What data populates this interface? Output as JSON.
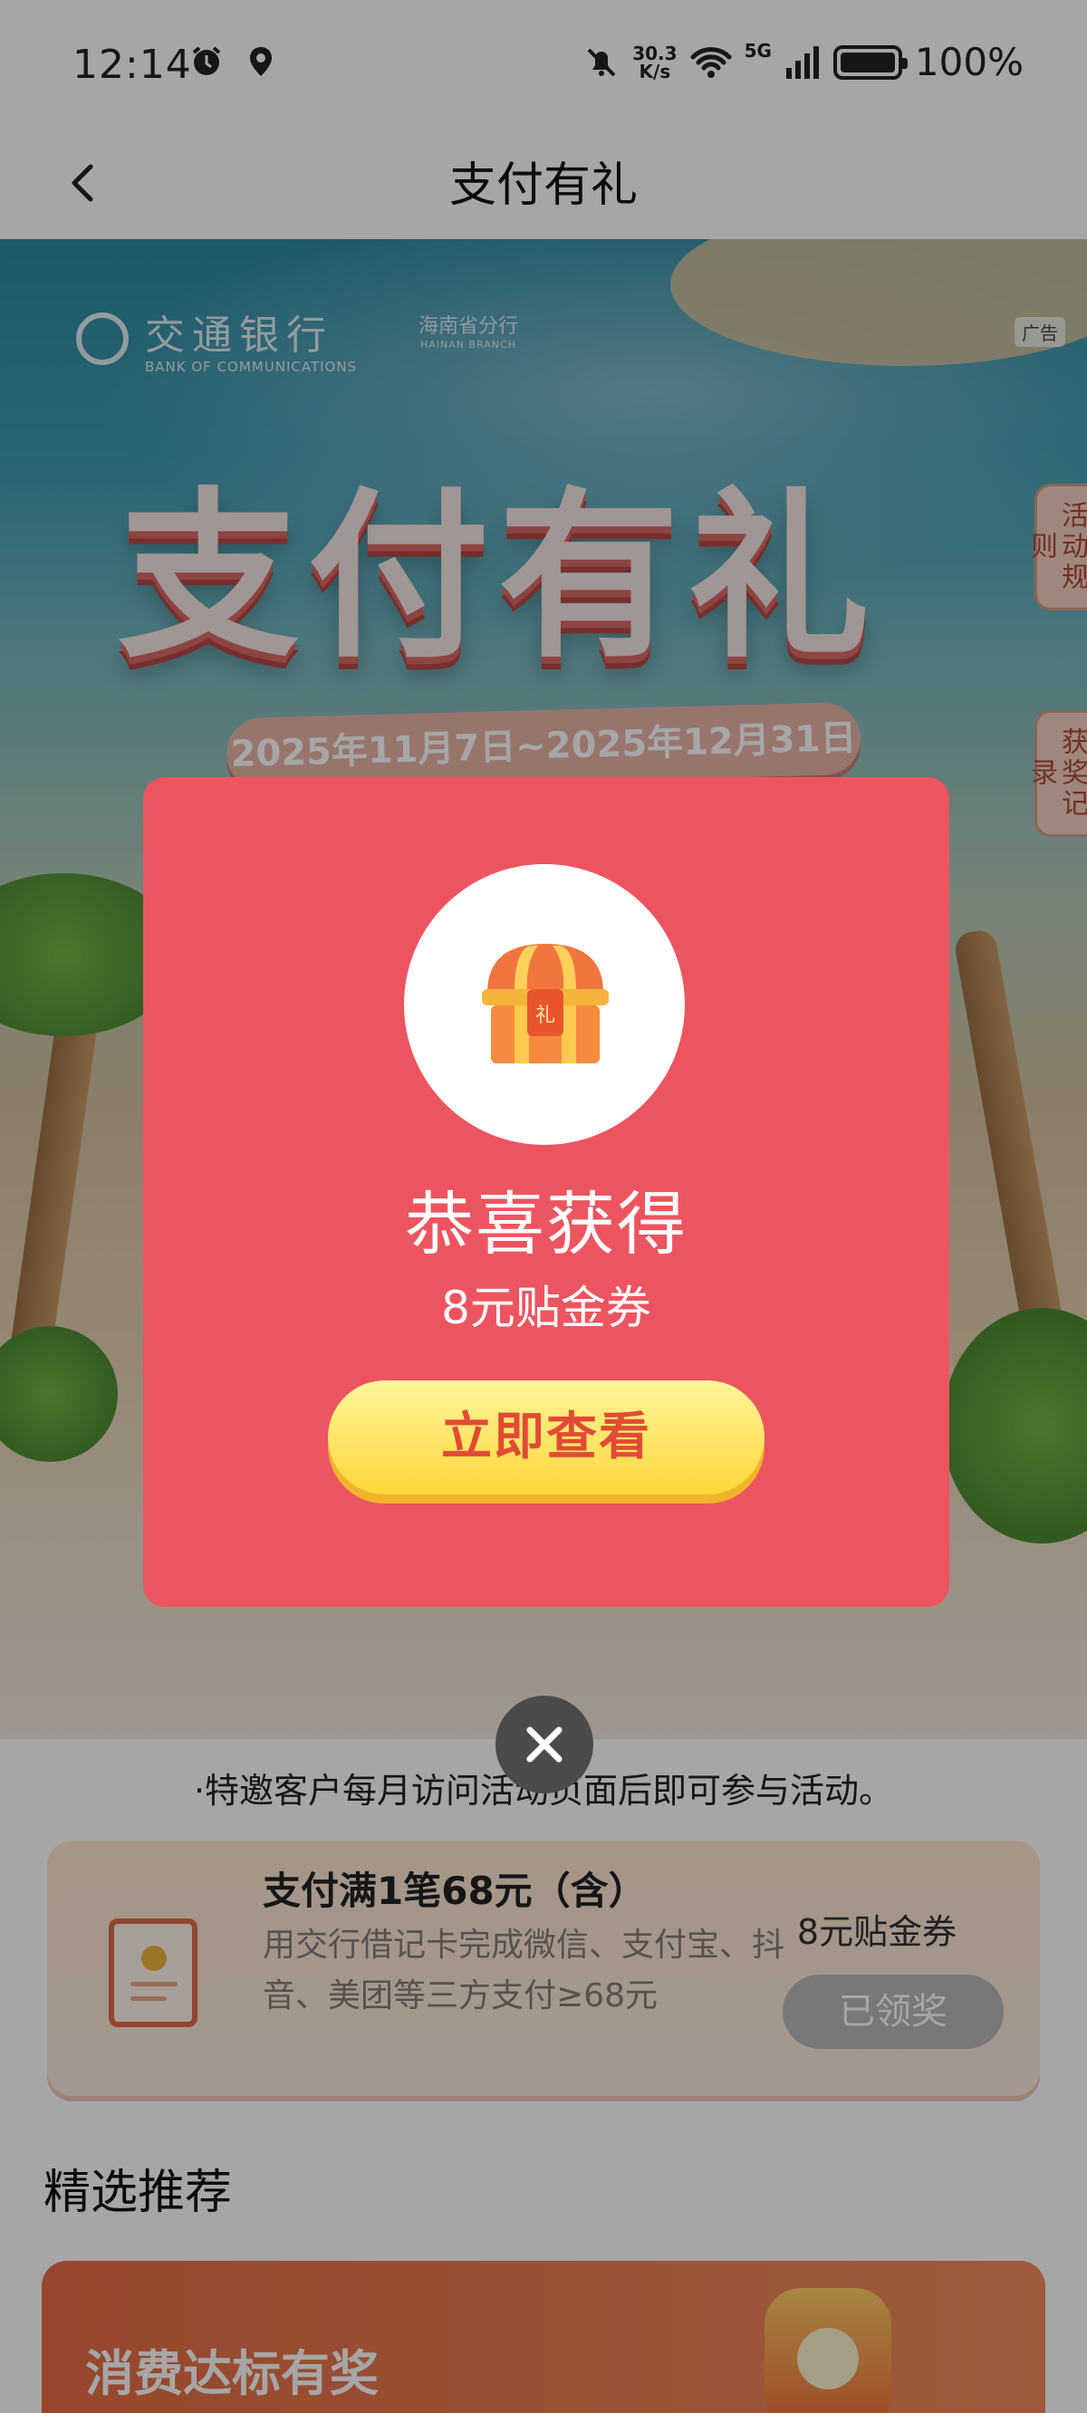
{
  "status_bar": {
    "time": "12:14",
    "net_speed_value": "30.3",
    "net_speed_unit": "K/s",
    "network": "5G",
    "battery": "100%"
  },
  "nav": {
    "title": "支付有礼"
  },
  "banner": {
    "bank_name_cn": "交通银行",
    "bank_name_en": "BANK OF COMMUNICATIONS",
    "branch_cn": "海南省分行",
    "branch_en": "HAINAN BRANCH",
    "ad_label": "广告",
    "headline": "支付有礼",
    "date_range": "2025年11月7日~2025年12月31日",
    "rules_tab": "活动规则",
    "records_tab": "获奖记录"
  },
  "notice": "·特邀客户每月访问活动页面后即可参与活动。",
  "task": {
    "title": "支付满1笔68元（含）",
    "description": "用交行借记卡完成微信、支付宝、抖音、美团等三方支付≥68元",
    "reward": "8元贴金券",
    "button": "已领奖"
  },
  "recommend": {
    "section_title": "精选推荐",
    "card_title": "消费达标有奖"
  },
  "modal": {
    "chest_label": "礼",
    "title": "恭喜获得",
    "prize": "8元贴金券",
    "button": "立即查看"
  }
}
